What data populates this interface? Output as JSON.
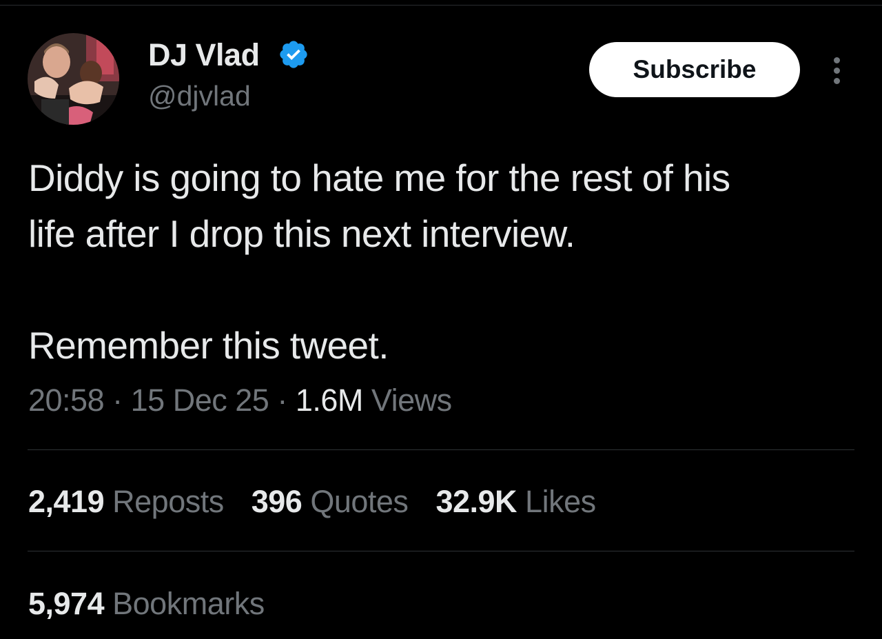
{
  "author": {
    "display_name": "DJ Vlad",
    "handle": "@djvlad",
    "avatar_icon": "avatar-photo",
    "verified_icon": "verified-badge-icon"
  },
  "actions": {
    "subscribe_label": "Subscribe",
    "more_icon": "more-vertical-icon"
  },
  "tweet": {
    "lines": [
      "Diddy is going to hate me for the rest of his",
      "life after I drop this next interview."
    ],
    "second_paragraph": "Remember this tweet."
  },
  "meta": {
    "time": "20:58",
    "date": "15 Dec 25",
    "views_count": "1.6M",
    "views_label": "Views",
    "separator": "·"
  },
  "stats": {
    "reposts_count": "2,419",
    "reposts_label": "Reposts",
    "quotes_count": "396",
    "quotes_label": "Quotes",
    "likes_count": "32.9K",
    "likes_label": "Likes",
    "bookmarks_count": "5,974",
    "bookmarks_label": "Bookmarks"
  },
  "colors": {
    "background": "#000000",
    "primary_text": "#e7e9ea",
    "secondary_text": "#71767b",
    "verified_blue": "#1d9bf0",
    "divider": "#2f3336"
  }
}
